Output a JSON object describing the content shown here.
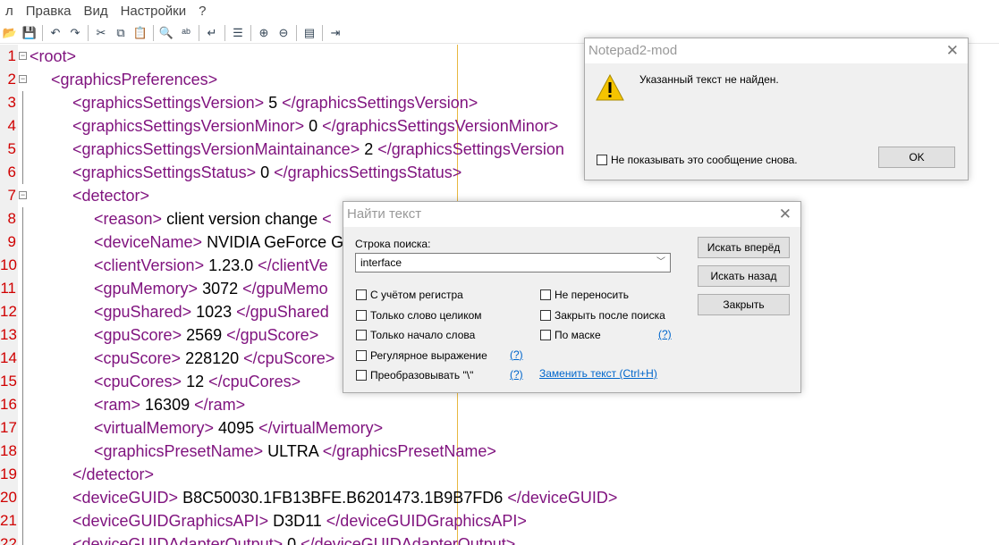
{
  "menu": [
    "л",
    "Правка",
    "Вид",
    "Настройки",
    "?"
  ],
  "toolbar": [
    "open-icon",
    "save-icon",
    "|",
    "undo-icon",
    "redo-icon",
    "|",
    "cut-icon",
    "copy-icon",
    "paste-icon",
    "|",
    "find-icon",
    "replace-icon",
    "|",
    "wordwrap-icon",
    "|",
    "list-icon",
    "|",
    "zoom-in-icon",
    "zoom-out-icon",
    "|",
    "view-icon",
    "|",
    "exit-icon"
  ],
  "colors": {
    "tag": "#80147f",
    "line_number": "#d00000",
    "edge": "#e8b840"
  },
  "lines": [
    {
      "n": "1",
      "indent": 0,
      "fold": "minus",
      "open": "<root>",
      "val": "",
      "close": ""
    },
    {
      "n": "2",
      "indent": 1,
      "fold": "minus",
      "open": "<graphicsPreferences>",
      "val": "",
      "close": ""
    },
    {
      "n": "3",
      "indent": 2,
      "open": "<graphicsSettingsVersion>",
      "val": " 5 ",
      "close": "</graphicsSettingsVersion>"
    },
    {
      "n": "4",
      "indent": 2,
      "open": "<graphicsSettingsVersionMinor>",
      "val": " 0 ",
      "close": "</graphicsSettingsVersionMinor>"
    },
    {
      "n": "5",
      "indent": 2,
      "open": "<graphicsSettingsVersionMaintainance>",
      "val": " 2 ",
      "close": "</graphicsSettingsVersion"
    },
    {
      "n": "6",
      "indent": 2,
      "open": "<graphicsSettingsStatus>",
      "val": " 0 ",
      "close": "</graphicsSettingsStatus>"
    },
    {
      "n": "7",
      "indent": 2,
      "fold": "minus",
      "open": "<detector>",
      "val": "",
      "close": ""
    },
    {
      "n": "8",
      "indent": 3,
      "open": "<reason>",
      "val": " client version change ",
      "close": "<"
    },
    {
      "n": "9",
      "indent": 3,
      "open": "<deviceName>",
      "val": " NVIDIA GeForce G",
      "close": ""
    },
    {
      "n": "10",
      "indent": 3,
      "open": "<clientVersion>",
      "val": " 1.23.0 ",
      "close": "</clientVe"
    },
    {
      "n": "11",
      "indent": 3,
      "open": "<gpuMemory>",
      "val": " 3072 ",
      "close": "</gpuMemo"
    },
    {
      "n": "12",
      "indent": 3,
      "open": "<gpuShared>",
      "val": " 1023 ",
      "close": "</gpuShared"
    },
    {
      "n": "13",
      "indent": 3,
      "open": "<gpuScore>",
      "val": " 2569 ",
      "close": "</gpuScore>"
    },
    {
      "n": "14",
      "indent": 3,
      "open": "<cpuScore>",
      "val": " 228120 ",
      "close": "</cpuScore>"
    },
    {
      "n": "15",
      "indent": 3,
      "open": "<cpuCores>",
      "val": " 12 ",
      "close": "</cpuCores>"
    },
    {
      "n": "16",
      "indent": 3,
      "open": "<ram>",
      "val": " 16309 ",
      "close": "</ram>"
    },
    {
      "n": "17",
      "indent": 3,
      "open": "<virtualMemory>",
      "val": " 4095 ",
      "close": "</virtualMemory>"
    },
    {
      "n": "18",
      "indent": 3,
      "open": "<graphicsPresetName>",
      "val": " ULTRA ",
      "close": "</graphicsPresetName>"
    },
    {
      "n": "19",
      "indent": 2,
      "open": "</detector>",
      "val": "",
      "close": ""
    },
    {
      "n": "20",
      "indent": 2,
      "open": "<deviceGUID>",
      "val": " B8C50030.1FB13BFE.B6201473.1B9B7FD6 ",
      "close": "</deviceGUID>"
    },
    {
      "n": "21",
      "indent": 2,
      "open": "<deviceGUIDGraphicsAPI>",
      "val": " D3D11 ",
      "close": "</deviceGUIDGraphicsAPI>"
    },
    {
      "n": "22",
      "indent": 2,
      "open": "<deviceGUIDAdapterOutput>",
      "val": " 0 ",
      "close": "</deviceGUIDAdapterOutput>"
    }
  ],
  "msgbox": {
    "title": "Notepad2-mod",
    "message": "Указанный текст не найден.",
    "checkbox": "Не показывать это сообщение снова.",
    "checked": false,
    "ok": "OK",
    "icon": "warning-icon"
  },
  "find": {
    "title": "Найти текст",
    "label": "Строка поиска:",
    "value": "interface",
    "find_next": "Искать вперёд",
    "find_prev": "Искать назад",
    "close": "Закрыть",
    "options_left": [
      {
        "label": "С учётом регистра",
        "checked": false
      },
      {
        "label": "Только слово целиком",
        "checked": false
      },
      {
        "label": "Только начало слова",
        "checked": false
      },
      {
        "label": "Регулярное выражение",
        "checked": false,
        "help": "(?)"
      },
      {
        "label": "Преобразовывать \"\\\"",
        "checked": false,
        "help": "(?)"
      }
    ],
    "options_right": [
      {
        "label": "Не переносить",
        "checked": false
      },
      {
        "label": "Закрыть после поиска",
        "checked": false
      },
      {
        "label": "По маске",
        "checked": false,
        "help": "(?)"
      }
    ],
    "replace_link": "Заменить текст (Ctrl+H)"
  }
}
